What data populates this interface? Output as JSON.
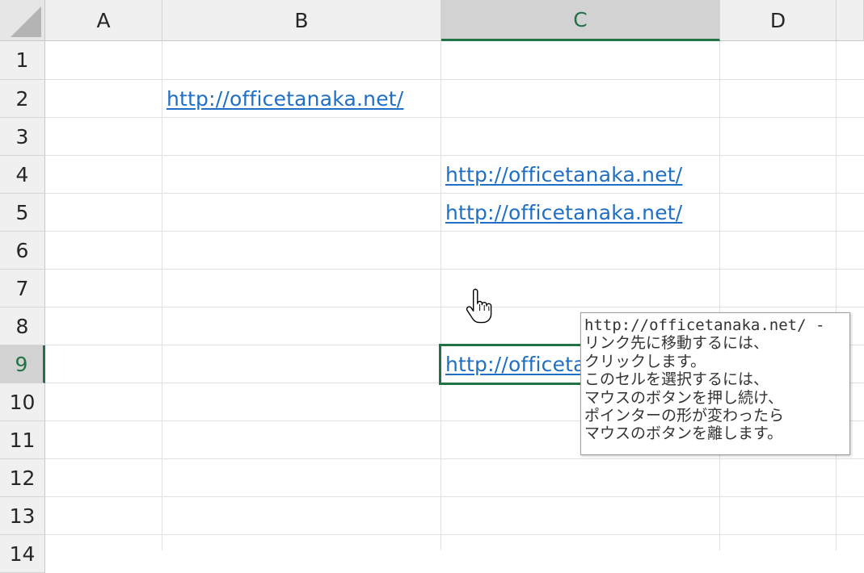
{
  "columns": [
    "A",
    "B",
    "C",
    "D"
  ],
  "rows": [
    "1",
    "2",
    "3",
    "4",
    "5",
    "6",
    "7",
    "8",
    "9",
    "10",
    "11",
    "12",
    "13",
    "14"
  ],
  "selection": {
    "column": "C",
    "row": "9"
  },
  "cells": {
    "B2": "http://officetanaka.net/",
    "C4": "http://officetanaka.net/",
    "C5": "http://officetanaka.net/",
    "C9": "http://officetanaka.net/"
  },
  "tooltip": {
    "lines": [
      "http://officetanaka.net/ -",
      "リンク先に移動するには、",
      "クリックします。",
      "このセルを選択するには、",
      "マウスのボタンを押し続け、",
      "ポインターの形が変わったら",
      "マウスのボタンを離します。"
    ]
  },
  "colors": {
    "link": "#1f6fc5",
    "selection_accent": "#217346"
  },
  "icons": {
    "corner": "select-all-triangle-icon",
    "cursor": "hand-pointer-icon"
  }
}
